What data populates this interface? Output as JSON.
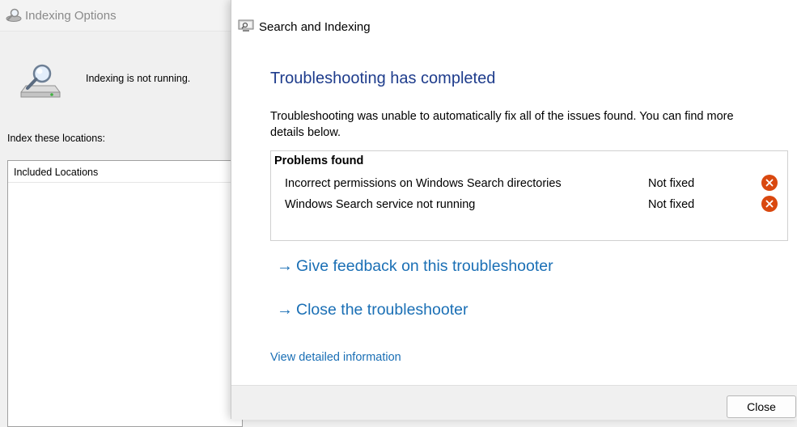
{
  "indexing_options": {
    "title": "Indexing Options",
    "status": "Indexing is not running.",
    "locations_label": "Index these locations:",
    "locations_column_header": "Included Locations"
  },
  "troubleshooter": {
    "title": "Search and Indexing",
    "heading": "Troubleshooting has completed",
    "description": "Troubleshooting was unable to automatically fix all of the issues found. You can find more details below.",
    "problems_title": "Problems found",
    "problems": [
      {
        "name": "Incorrect permissions on Windows Search directories",
        "status": "Not fixed",
        "icon": "error-x-icon"
      },
      {
        "name": "Windows Search service not running",
        "status": "Not fixed",
        "icon": "error-x-icon"
      }
    ],
    "links": {
      "feedback": "Give feedback on this troubleshooter",
      "close": "Close the troubleshooter",
      "details": "View detailed information"
    },
    "close_button": "Close"
  },
  "colors": {
    "heading": "#1e3c8c",
    "link": "#1a6fb5",
    "error": "#d9480f"
  }
}
